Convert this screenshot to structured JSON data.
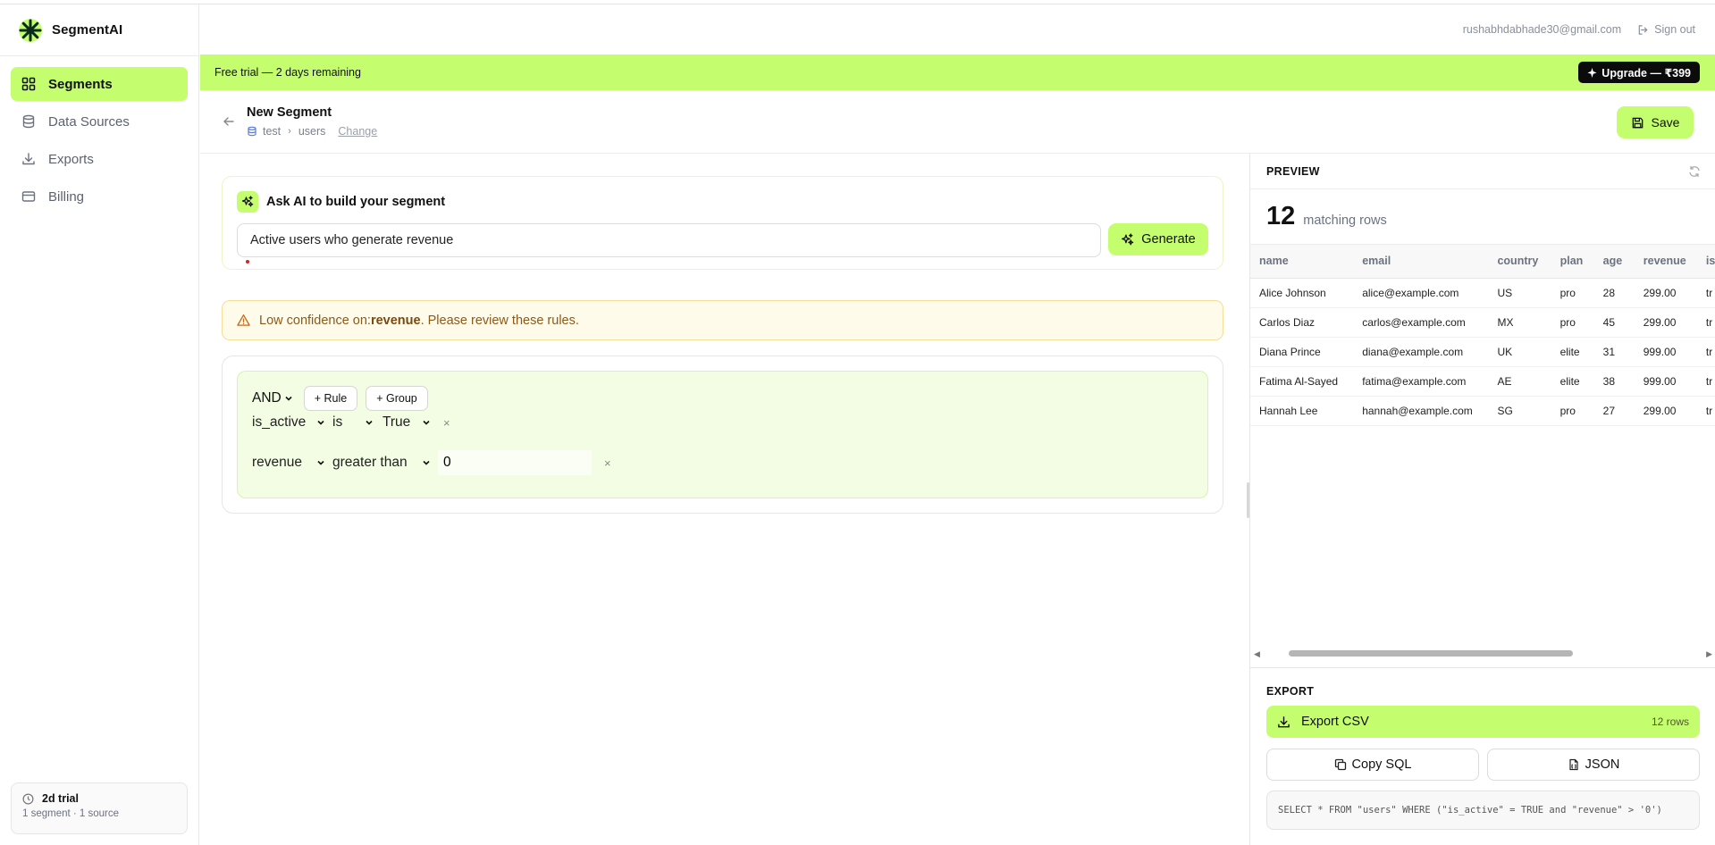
{
  "brand": {
    "name": "SegmentAI",
    "icon": "asterisk-logo-icon",
    "accent": "#c4fd6e"
  },
  "sidebar": {
    "items": [
      {
        "label": "Segments",
        "icon": "grid-icon",
        "active": true
      },
      {
        "label": "Data Sources",
        "icon": "database-icon",
        "active": false
      },
      {
        "label": "Exports",
        "icon": "download-icon",
        "active": false
      },
      {
        "label": "Billing",
        "icon": "credit-card-icon",
        "active": false
      }
    ],
    "trial": {
      "title": "2d trial",
      "subtitle": "1 segment · 1 source"
    }
  },
  "header": {
    "email": "rushabhdabhade30@gmail.com",
    "signout": "Sign out"
  },
  "banner": {
    "text": "Free trial — 2 days remaining",
    "upgrade": "Upgrade — ₹399"
  },
  "segment": {
    "title": "New Segment",
    "source": "test",
    "table": "users",
    "change": "Change",
    "save": "Save"
  },
  "ai": {
    "title": "Ask AI to build your segment",
    "prompt": "Active users who generate revenue",
    "generate": "Generate"
  },
  "warning": {
    "prefix": "Low confidence on: ",
    "field": "revenue",
    "suffix": ". Please review these rules."
  },
  "rules": {
    "operator": "AND",
    "add_rule": "+ Rule",
    "add_group": "+ Group",
    "items": [
      {
        "field": "is_active",
        "op": "is",
        "value": "True",
        "remove": "×"
      },
      {
        "field": "revenue",
        "op": "greater than",
        "value": "0",
        "remove": "×"
      }
    ]
  },
  "preview": {
    "title": "PREVIEW",
    "count": "12",
    "count_label": "matching rows",
    "columns": [
      "name",
      "email",
      "country",
      "plan",
      "age",
      "revenue",
      "is"
    ],
    "rows": [
      [
        "Alice Johnson",
        "alice@example.com",
        "US",
        "pro",
        "28",
        "299.00",
        "tr"
      ],
      [
        "Carlos Diaz",
        "carlos@example.com",
        "MX",
        "pro",
        "45",
        "299.00",
        "tr"
      ],
      [
        "Diana Prince",
        "diana@example.com",
        "UK",
        "elite",
        "31",
        "999.00",
        "tr"
      ],
      [
        "Fatima Al-Sayed",
        "fatima@example.com",
        "AE",
        "elite",
        "38",
        "999.00",
        "tr"
      ],
      [
        "Hannah Lee",
        "hannah@example.com",
        "SG",
        "pro",
        "27",
        "299.00",
        "tr"
      ]
    ]
  },
  "export": {
    "title": "EXPORT",
    "csv": "Export CSV",
    "csv_rows": "12 rows",
    "copy_sql": "Copy SQL",
    "json": "JSON",
    "sql": "SELECT * FROM \"users\" WHERE (\"is_active\" = TRUE and \"revenue\" > '0')"
  }
}
